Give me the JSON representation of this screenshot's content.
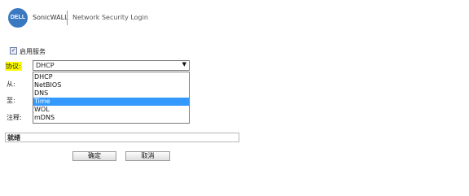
{
  "header": {
    "logo_text": "DELL",
    "brand": "SonicWALL",
    "title": "Network Security Login"
  },
  "form": {
    "enable": {
      "label": "启用服务",
      "checked": true,
      "mark": "✓"
    },
    "protocol": {
      "label": "协议:",
      "selected": "DHCP",
      "options": [
        "DHCP",
        "NetBIOS",
        "DNS",
        "Time",
        "WOL",
        "mDNS"
      ],
      "highlighted_option": "Time"
    },
    "from_label": "从:",
    "to_label": "至:",
    "comment_label": "注释:"
  },
  "status": {
    "text": "就绪"
  },
  "buttons": {
    "ok": "确定",
    "cancel": "取消"
  },
  "colors": {
    "highlight": "#3399ff",
    "label_highlight": "#ffff00",
    "logo": "#3a78c2"
  }
}
